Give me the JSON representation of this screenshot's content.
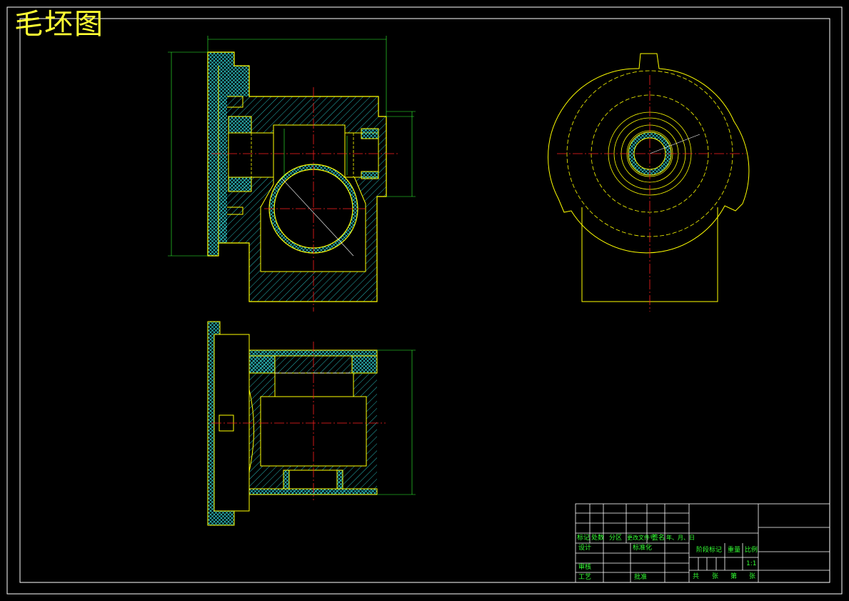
{
  "drawing": {
    "title": "毛坯图",
    "colors": {
      "background": "#000000",
      "outline": "#ffff00",
      "centerline": "#ff2020",
      "dimension": "#33ff33",
      "hatch": "#2ec7c7",
      "frame": "#ffffff"
    }
  },
  "title_block": {
    "row_labels": [
      "标记",
      "处数",
      "分区",
      "更改文件号",
      "签名",
      "年、月、日"
    ],
    "design": "设计",
    "standardize": "标准化",
    "review": "审核",
    "process": "工艺",
    "approve": "批准",
    "stage_mark": "阶段标记",
    "weight": "重量",
    "scale": "比例",
    "scale_value": "1:1",
    "sheet_total": "共",
    "sheet_unit1": "张",
    "sheet_of": "第",
    "sheet_unit2": "张"
  }
}
